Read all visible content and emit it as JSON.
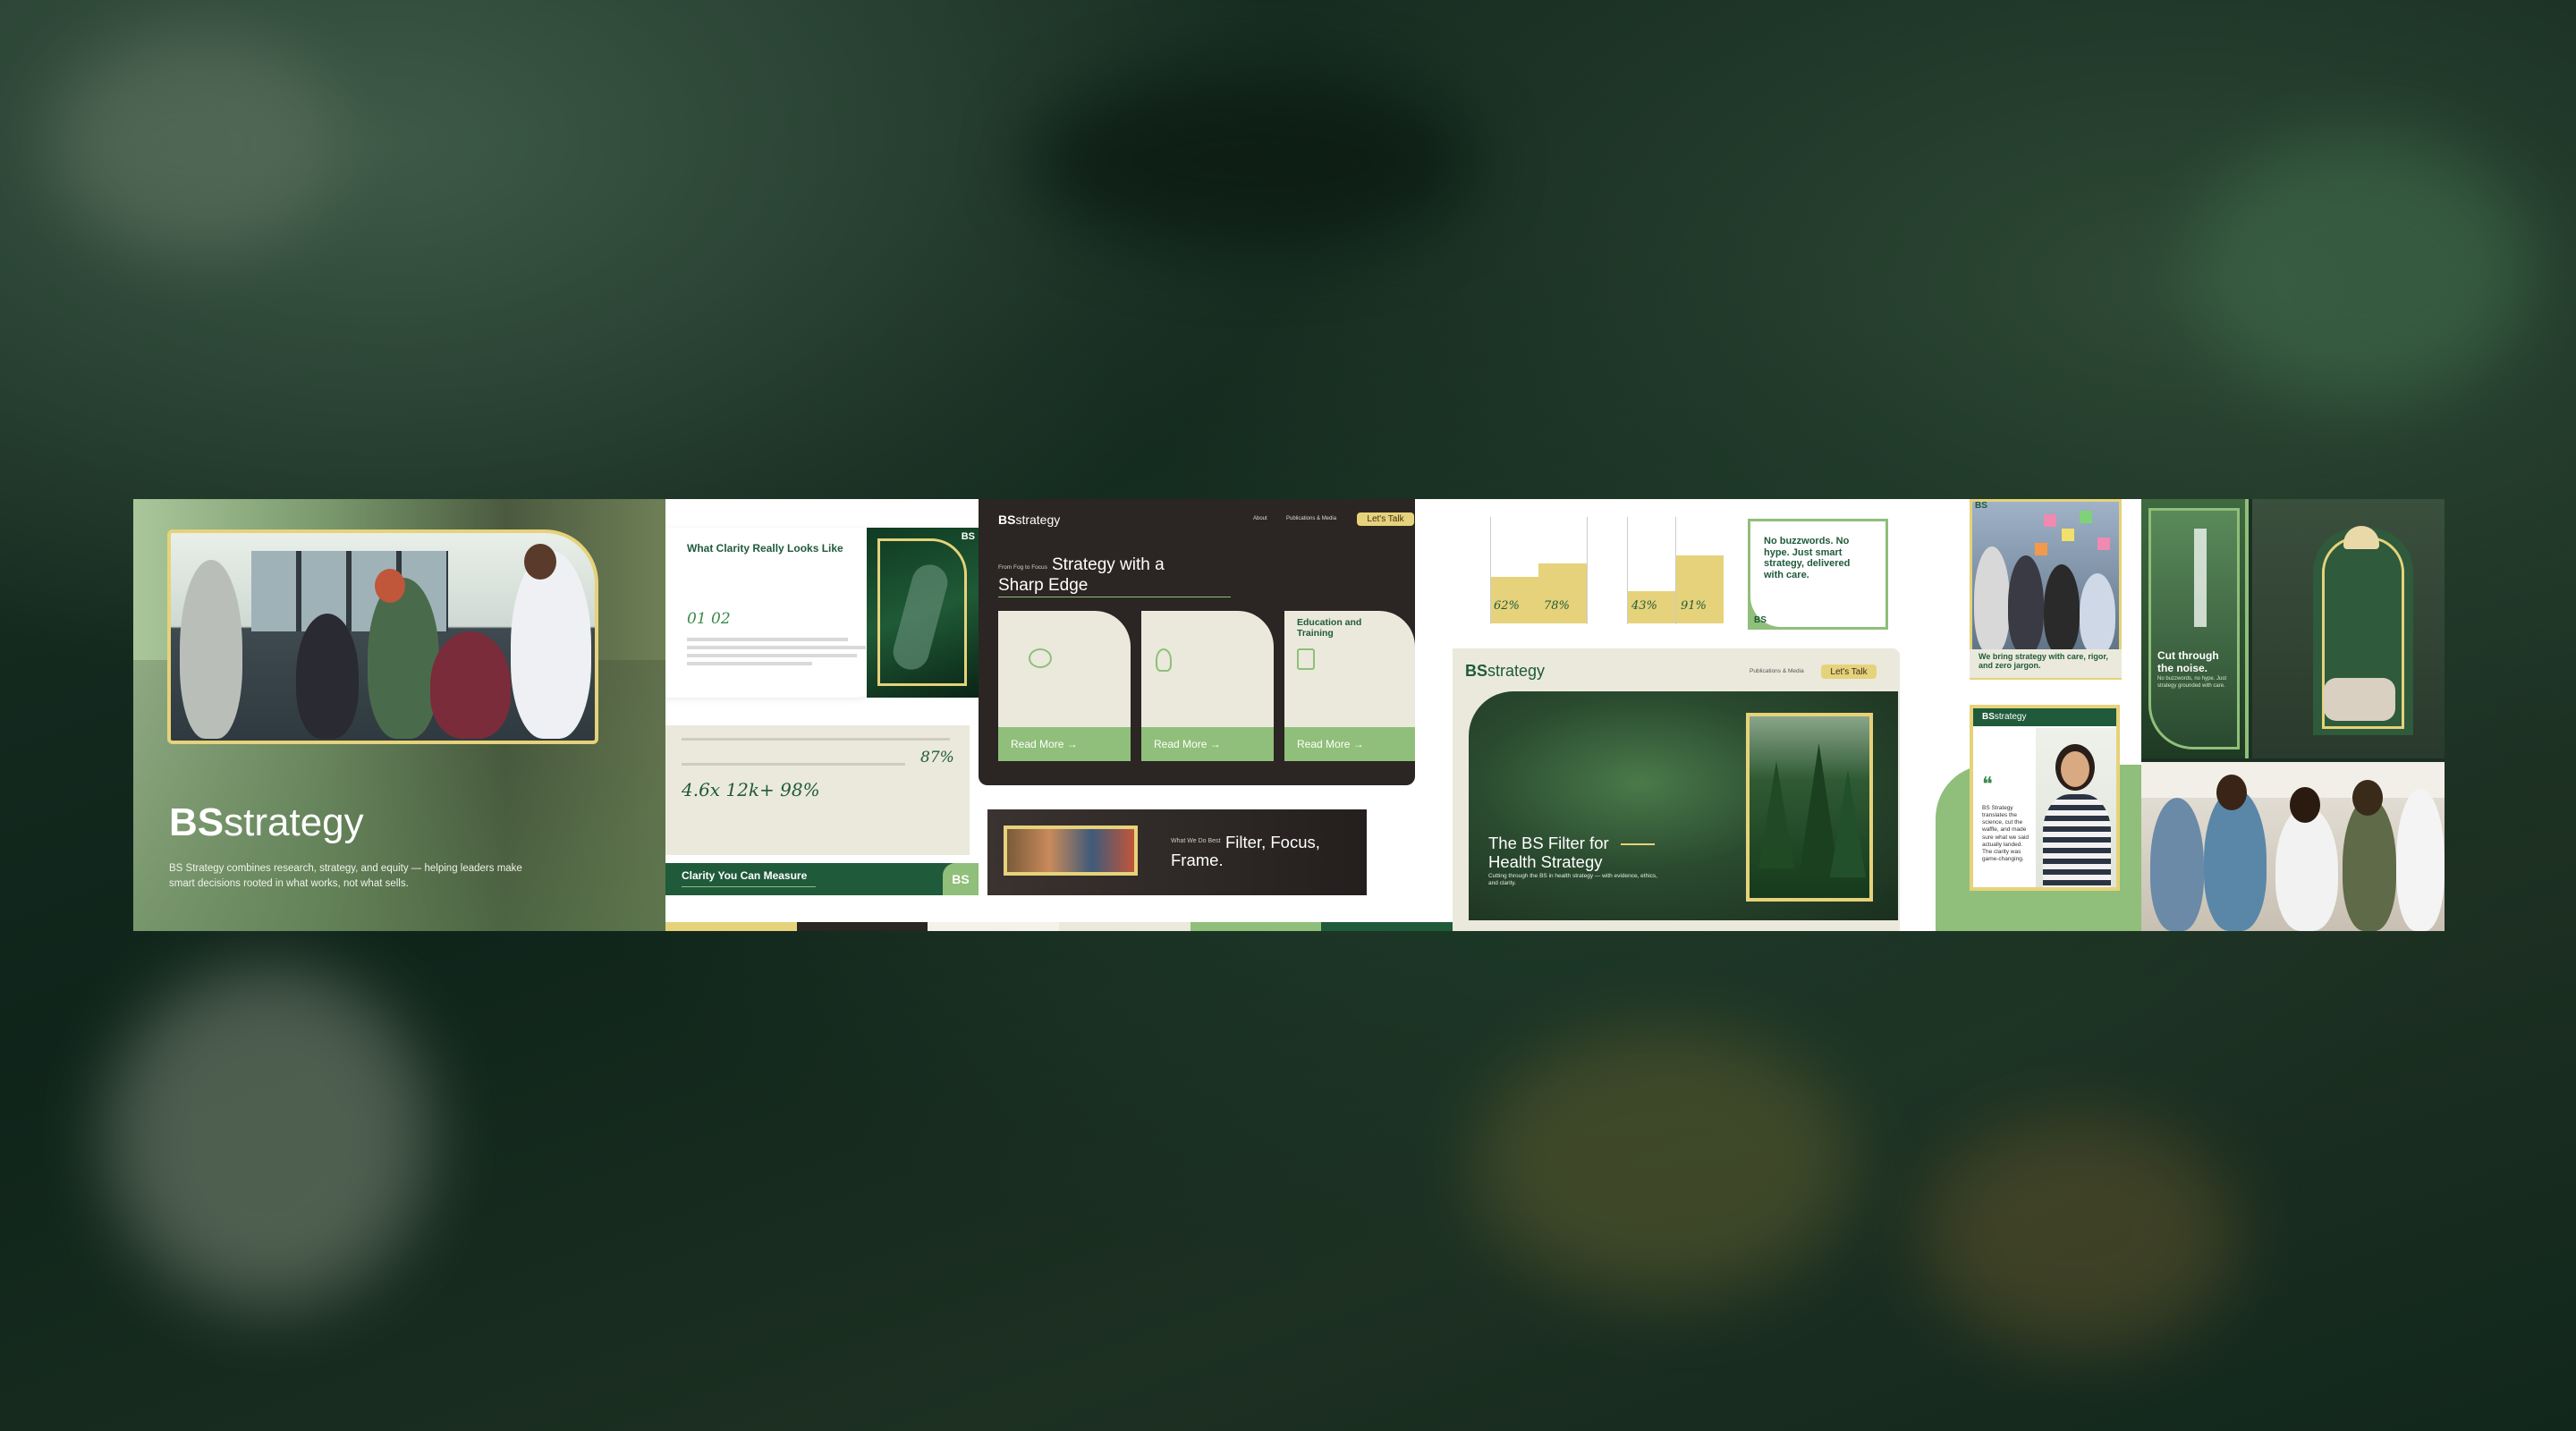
{
  "panel1": {
    "logo_bold": "BS",
    "logo_light": "strategy",
    "description": "BS Strategy combines research, strategy, and equity — helping leaders make smart decisions rooted in what works, not what sells."
  },
  "panel2": {
    "heading": "What Clarity Really Looks Like",
    "numbers": "01  02",
    "badge": "BS",
    "footer_title": "Clarity You Can Measure",
    "footer_badge": "BS",
    "stat_left": "4.6x  12k+  98%",
    "stat_right": "87%"
  },
  "panel3": {
    "logo_bold": "BS",
    "logo_light": "strategy",
    "nav": [
      "About",
      "Publications & Media"
    ],
    "cta": "Let's Talk",
    "kicker": "From Fog to Focus",
    "hero_line1": "Strategy with a",
    "hero_line2": "Sharp Edge",
    "cards": [
      {
        "title": "",
        "cta": "Read More →"
      },
      {
        "title": "",
        "cta": "Read More →"
      },
      {
        "title": "Education and Training",
        "cta": "Read More →"
      }
    ],
    "banner_kicker": "What We Do Best",
    "banner_title_line1": "Filter, Focus,",
    "banner_title_line2": "Frame."
  },
  "panel4": {
    "bars": [
      "62%",
      "78%",
      "43%",
      "91%"
    ],
    "quote": "No buzzwords. No hype. Just smart strategy, delivered with care.",
    "quote_badge": "BS",
    "logo_bold": "BS",
    "logo_light": "strategy",
    "nav": "Publications & Media",
    "cta": "Let's Talk",
    "hero_line1": "The BS Filter for",
    "hero_line2": "Health Strategy",
    "hero_sub": "Cutting through the BS in health strategy — with evidence, ethics, and clarity."
  },
  "panel5": {
    "badge": "BS",
    "caption": "We bring strategy with care, rigor, and zero jargon.",
    "logo_bold": "BS",
    "logo_light": "strategy",
    "quote_mark": "❝",
    "testimonial": "BS Strategy translates the science, cut the waffle, and made sure what we said actually landed. The clarity was game-changing."
  },
  "panel6": {
    "title_line1": "Cut through",
    "title_line2": "the noise.",
    "sub": "No buzzwords, no hype. Just strategy grounded with care."
  },
  "colors": {
    "brand_green": "#1f5a3b",
    "light_green": "#8fbf7a",
    "accent_yellow": "#e6d27a",
    "cream": "#ebe9dc",
    "dark_brown": "#2b2523"
  }
}
